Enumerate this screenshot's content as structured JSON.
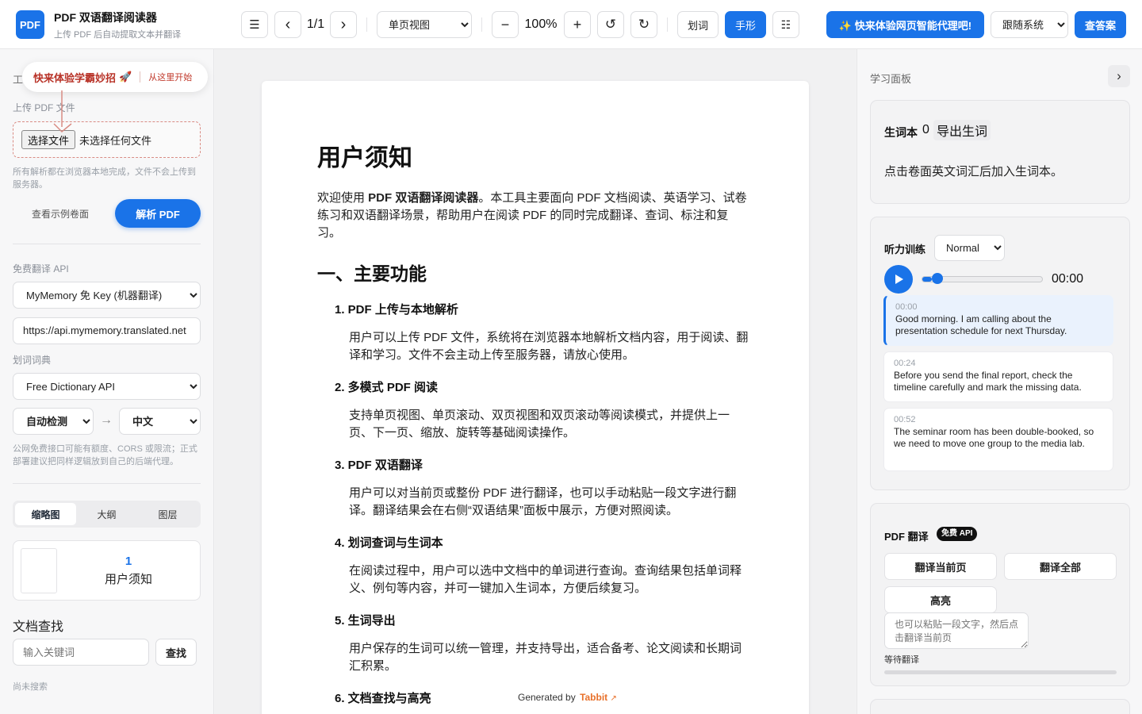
{
  "header": {
    "logo": "PDF",
    "title": "PDF 双语翻译阅读器",
    "subtitle": "上传 PDF 后自动提取文本并翻译",
    "menu_icon": "☰",
    "prev_icon": "‹",
    "page_indicator": "1/1",
    "next_icon": "›",
    "view_mode": "单页视图",
    "zoom_out": "−",
    "zoom_level": "100%",
    "zoom_in": "+",
    "rotate_left": "↺",
    "rotate_right": "↻",
    "select_word": "划词",
    "hand_tool": "手形",
    "grid_icon": "☷",
    "promo": "✨ 快来体验网页智能代理吧!",
    "theme": "跟随系统",
    "answer_button": "查答案"
  },
  "left": {
    "tooltip_title": "快来体验学霸妙招",
    "tooltip_rocket": "🚀",
    "tooltip_link": "从这里开始",
    "section_partial": "工",
    "upload_label": "上传 PDF 文件",
    "choose_file": "选择文件",
    "no_file": "未选择任何文件",
    "privacy_note": "所有解析都在浏览器本地完成，文件不会上传到服务器。",
    "sample_button": "查看示例卷面",
    "parse_button": "解析 PDF",
    "api_label": "免费翻译 API",
    "api_select": "MyMemory 免 Key (机器翻译)",
    "api_url": "https://api.mymemory.translated.net",
    "dict_label": "划词词典",
    "dict_select": "Free Dictionary API",
    "source_lang": "自动检测",
    "arrow": "→",
    "target_lang": "中文",
    "cors_note": "公网免费接口可能有额度、CORS 或限流；正式部署建议把同样逻辑放到自己的后端代理。",
    "tabs": [
      "缩略图",
      "大纲",
      "图层"
    ],
    "thumb_num": "1",
    "thumb_title": "用户须知",
    "search_title": "文档查找",
    "search_placeholder": "输入关键词",
    "search_button": "查找",
    "search_status": "尚未搜索"
  },
  "doc": {
    "title": "用户须知",
    "intro_pre": "欢迎使用 ",
    "intro_bold": "PDF 双语翻译阅读器",
    "intro_post": "。本工具主要面向 PDF 文档阅读、英语学习、试卷练习和双语翻译场景，帮助用户在阅读 PDF 的同时完成翻译、查词、标注和复习。",
    "section1": "一、主要功能",
    "items": [
      {
        "title": "1. PDF 上传与本地解析",
        "body": "用户可以上传 PDF 文件，系统将在浏览器本地解析文档内容，用于阅读、翻译和学习。文件不会主动上传至服务器，请放心使用。"
      },
      {
        "title": "2. 多模式 PDF 阅读",
        "body": "支持单页视图、单页滚动、双页视图和双页滚动等阅读模式，并提供上一页、下一页、缩放、旋转等基础阅读操作。"
      },
      {
        "title": "3. PDF 双语翻译",
        "body": "用户可以对当前页或整份 PDF 进行翻译，也可以手动粘贴一段文字进行翻译。翻译结果会在右侧“双语结果”面板中展示，方便对照阅读。"
      },
      {
        "title": "4. 划词查词与生词本",
        "body": "在阅读过程中，用户可以选中文档中的单词进行查询。查询结果包括单词释义、例句等内容，并可一键加入生词本，方便后续复习。"
      },
      {
        "title": "5. 生词导出",
        "body": "用户保存的生词可以统一管理，并支持导出，适合备考、论文阅读和长期词汇积累。"
      },
      {
        "title": "6. 文档查找与高亮",
        "body": ""
      }
    ],
    "generated_by": "Generated by",
    "brand": "Tabbit",
    "brand_arrow": "↗"
  },
  "right": {
    "panel_title": "学习面板",
    "collapse": "›",
    "vocab_label": "生词本",
    "vocab_count": "0",
    "export_label": "导出生词",
    "vocab_hint": "点击卷面英文词汇后加入生词本。",
    "listen_label": "听力训练",
    "speed": "Normal",
    "time": "00:00",
    "progress": 0.08,
    "transcript": [
      {
        "t": "00:00",
        "s": "Good morning. I am calling about the presentation schedule for next Thursday."
      },
      {
        "t": "00:24",
        "s": "Before you send the final report, check the timeline carefully and mark the missing data."
      },
      {
        "t": "00:52",
        "s": "The seminar room has been double-booked, so we need to move one group to the media lab."
      }
    ],
    "trans_label": "PDF 翻译",
    "free_badge": "免费 API",
    "translate_page": "翻译当前页",
    "translate_all": "翻译全部",
    "highlight": "高亮",
    "textarea_placeholder": "也可以粘贴一段文字，然后点击翻译当前页",
    "status": "等待翻译"
  },
  "colors": {
    "accent": "#1a73e8",
    "danger": "#c0392b",
    "brand": "#e8702a"
  }
}
